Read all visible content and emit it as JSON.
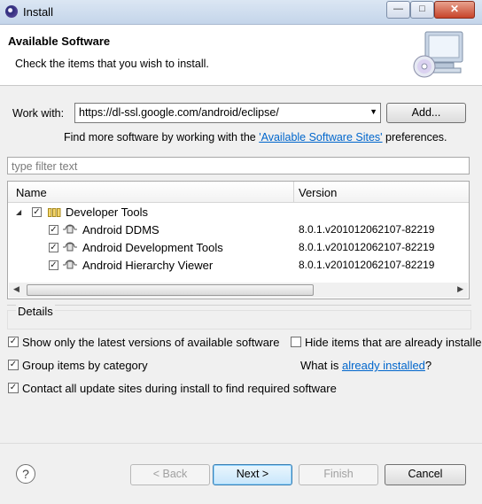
{
  "window": {
    "title": "Install",
    "minimize_glyph": "—",
    "maximize_glyph": "□",
    "close_glyph": "✕"
  },
  "banner": {
    "title": "Available Software",
    "subtitle": "Check the items that you wish to install."
  },
  "work_with": {
    "label": "Work with:",
    "value": "https://dl-ssl.google.com/android/eclipse/",
    "add_button": "Add...",
    "more_prefix": "Find more software by working with the ",
    "more_link": "'Available Software Sites'",
    "more_suffix": " preferences."
  },
  "filter": {
    "placeholder": "type filter text"
  },
  "tree": {
    "columns": [
      "Name",
      "Version"
    ],
    "category": {
      "label": "Developer Tools",
      "checked": true,
      "expanded": true
    },
    "items": [
      {
        "name": "Android DDMS",
        "version": "8.0.1.v201012062107-82219",
        "checked": true
      },
      {
        "name": "Android Development Tools",
        "version": "8.0.1.v201012062107-82219",
        "checked": true
      },
      {
        "name": "Android Hierarchy Viewer",
        "version": "8.0.1.v201012062107-82219",
        "checked": true
      }
    ]
  },
  "details": {
    "label": "Details"
  },
  "options": {
    "show_latest": "Show only the latest versions of available software",
    "hide_installed": "Hide items that are already installed",
    "group_by_category": "Group items by category",
    "what_is_prefix": "What is ",
    "what_is_link": "already installed",
    "what_is_suffix": "?",
    "contact_sites": "Contact all update sites during install to find required software"
  },
  "buttons": {
    "back": "< Back",
    "next": "Next >",
    "finish": "Finish",
    "cancel": "Cancel",
    "help": "?"
  },
  "colors": {
    "link": "#0066cc",
    "title_bar": "#c4d5ea",
    "default_button": "#3c7fb1"
  }
}
